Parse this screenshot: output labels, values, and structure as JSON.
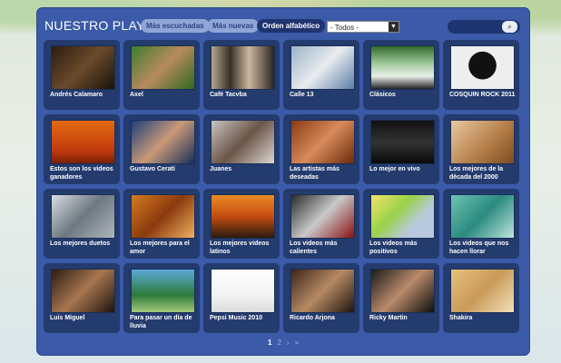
{
  "header": {
    "title": "NUESTRO PLAYLIST",
    "filters": [
      "Más escuchadas",
      "Más nuevas",
      "Orden alfabético"
    ],
    "active_filter": 2,
    "select_value": "- Todos -",
    "search_value": ""
  },
  "tiles": [
    {
      "label": "Andrés Calamaro",
      "bg": "linear-gradient(135deg,#2a1d12,#6b4a2a 50%,#1a120b)"
    },
    {
      "label": "Axel",
      "bg": "linear-gradient(135deg,#3c7d2c,#b98a5e 50%,#2f6a22)"
    },
    {
      "label": "Café Tacvba",
      "bg": "linear-gradient(90deg,#b6a691,#3a2f26 30%,#cbb89f 60%,#2c241d)"
    },
    {
      "label": "Calle 13",
      "bg": "linear-gradient(135deg,#9cb3c9,#e9ecef 50%,#5b7ea6)"
    },
    {
      "label": "Clásicos",
      "bg": "linear-gradient(180deg,#2f6a2a,#9fc89a 40%,#e9efe8 70%,#222)"
    },
    {
      "label": "COSQUIN ROCK 2011",
      "bg": "radial-gradient(circle at 50% 45%,#111 0 35%,#eee 36% 100%)"
    },
    {
      "label": "Estos son los videos ganadores",
      "bg": "linear-gradient(180deg,#e36b12,#c23a0c 70%,#7a1f05)"
    },
    {
      "label": "Gustavo Cerati",
      "bg": "linear-gradient(135deg,#1d3f7a,#c99a78 50%,#1a2d57)"
    },
    {
      "label": "Juanes",
      "bg": "linear-gradient(135deg,#c9c5c0,#6b5548 50%,#ddd7d1)"
    },
    {
      "label": "Las artistas más deseadas",
      "bg": "linear-gradient(135deg,#8a3a12,#d88a5a 50%,#6a2a0c)"
    },
    {
      "label": "Lo mejor en vivo",
      "bg": "linear-gradient(180deg,#111,#333 50%,#0a0a0a)"
    },
    {
      "label": "Los mejores de la década del 2000",
      "bg": "linear-gradient(135deg,#e8c9a2,#b27b45 60%,#7a4c22)"
    },
    {
      "label": "Los mejores duetos",
      "bg": "linear-gradient(135deg,#d8dde2,#6d7880 50%,#aeb6bd)"
    },
    {
      "label": "Los mejores para el amor",
      "bg": "linear-gradient(135deg,#d57a1e,#8a3a0e 50%,#f0b060)"
    },
    {
      "label": "Los mejores videos latinos",
      "bg": "linear-gradient(180deg,#e98b25,#c44c10 50%,#2a1a0e)"
    },
    {
      "label": "Los videos más calientes",
      "bg": "linear-gradient(135deg,#2a2a2a,#c9c9c9 50%,#8a1010)"
    },
    {
      "label": "Los videos más positivos",
      "bg": "linear-gradient(135deg,#f2e36a,#9ad24a 40%,#b9c9dd 70%)"
    },
    {
      "label": "Los videos que nos hacen llorar",
      "bg": "linear-gradient(135deg,#6fc2b6,#2b8a7e 50%,#bfe6df)"
    },
    {
      "label": "Luis Miguel",
      "bg": "linear-gradient(135deg,#2a1c14,#a8764f 50%,#1d130d)"
    },
    {
      "label": "Para pasar un día de lluvia",
      "bg": "linear-gradient(180deg,#5aa9d8,#2e7a3a 60%,#a3c87a)"
    },
    {
      "label": "Pepsi Music 2010",
      "bg": "linear-gradient(180deg,#ffffff,#f2f2f2 60%,#dcdcdc)"
    },
    {
      "label": "Ricardo Arjona",
      "bg": "linear-gradient(135deg,#3a2418,#b58a63 50%,#1f140d)"
    },
    {
      "label": "Ricky Martin",
      "bg": "linear-gradient(135deg,#1a1a1a,#b98a6a 50%,#0d0d0d)"
    },
    {
      "label": "Shakira",
      "bg": "linear-gradient(135deg,#e7c27a,#c99a5a 50%,#f3e1b8)"
    }
  ],
  "pager": [
    "1",
    "2",
    "›",
    "»"
  ],
  "pager_current": 0
}
